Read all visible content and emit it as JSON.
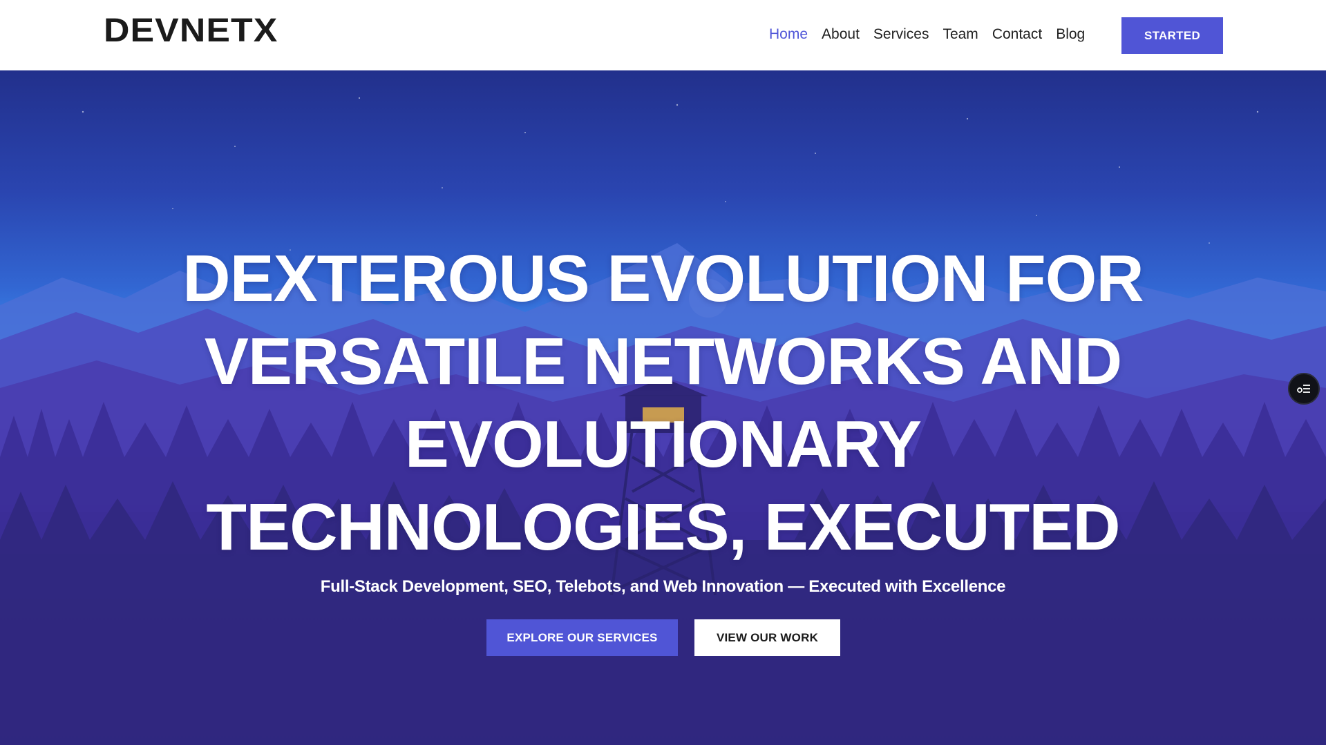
{
  "brand": {
    "logo": "DEVNETX"
  },
  "nav": {
    "items": [
      {
        "label": "Home",
        "active": true
      },
      {
        "label": "About",
        "active": false
      },
      {
        "label": "Services",
        "active": false
      },
      {
        "label": "Team",
        "active": false
      },
      {
        "label": "Contact",
        "active": false
      },
      {
        "label": "Blog",
        "active": false
      }
    ],
    "cta_label": "STARTED"
  },
  "hero": {
    "headline_lines": [
      "DEXTEROUS EVOLUTION FOR",
      "VERSATILE NETWORKS AND",
      "EVOLUTIONARY",
      "TECHNOLOGIES, EXECUTED"
    ],
    "subtitle": "Full-Stack Development, SEO, Telebots, and Web Innovation — Executed with Excellence",
    "primary_button": "EXPLORE OUR SERVICES",
    "secondary_button": "VIEW OUR WORK",
    "background_icon": "forest-watchtower-illustration"
  },
  "floating": {
    "icon": "settings-list-icon"
  },
  "colors": {
    "accent": "#5055d6",
    "nav_active": "#4f55d8",
    "header_bg": "#ffffff",
    "hero_dark": "#24216e"
  }
}
